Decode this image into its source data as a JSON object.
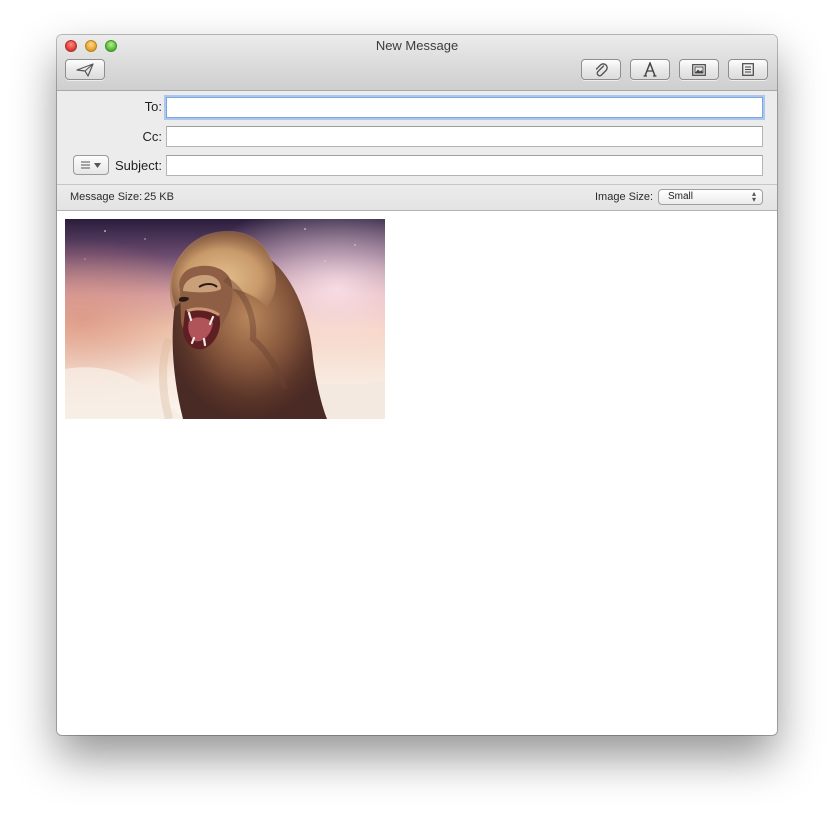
{
  "window": {
    "title": "New Message"
  },
  "toolbar": {
    "send_icon": "paper-plane-icon",
    "attach_icon": "paperclip-icon",
    "format_icon": "font-A-icon",
    "photo_icon": "photo-browser-icon",
    "stationery_icon": "stationery-icon"
  },
  "fields": {
    "to_label": "To:",
    "to_value": "",
    "cc_label": "Cc:",
    "cc_value": "",
    "subject_label": "Subject:",
    "subject_value": "",
    "menu_icon": "header-fields-menu-icon"
  },
  "info": {
    "message_size_label": "Message Size:",
    "message_size_value": "25 KB",
    "image_size_label": "Image Size:",
    "image_size_selected": "Small"
  },
  "body": {
    "attachment": "roaring-lion-image"
  },
  "colors": {
    "focus_ring": "#a9c7ef",
    "close": "#e0443e",
    "minimize": "#e9a737",
    "zoom": "#5fbf3b"
  }
}
